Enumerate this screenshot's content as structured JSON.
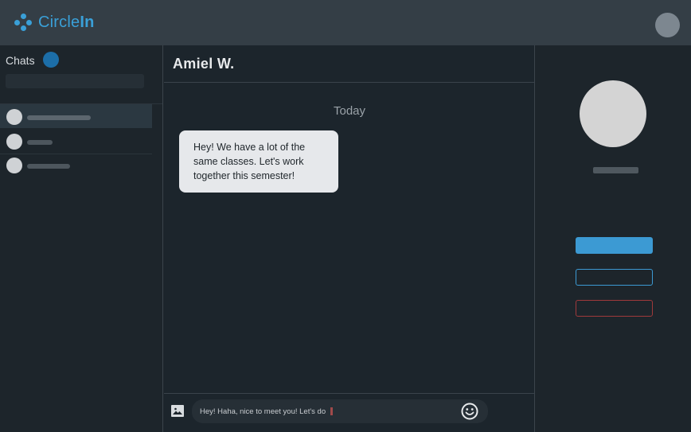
{
  "app": {
    "logo_text_light": "Circle",
    "logo_text_bold": "In",
    "brand_color": "#3aa0d8"
  },
  "sidebar": {
    "chats_label": "Chats",
    "badge_color": "#1c6ea8"
  },
  "conversation": {
    "title": "Amiel W.",
    "day_label": "Today",
    "messages": [
      {
        "text": "Hey! We have a lot of the same classes. Let's work together this semester!"
      }
    ]
  },
  "composer": {
    "value": "Hey! Haha, nice to meet you! Let's do ",
    "emoji_icon": "smiley-icon",
    "image_icon": "image-icon"
  },
  "profile": {
    "primary_color": "#3c9ad3",
    "danger_color": "#a0393b"
  }
}
